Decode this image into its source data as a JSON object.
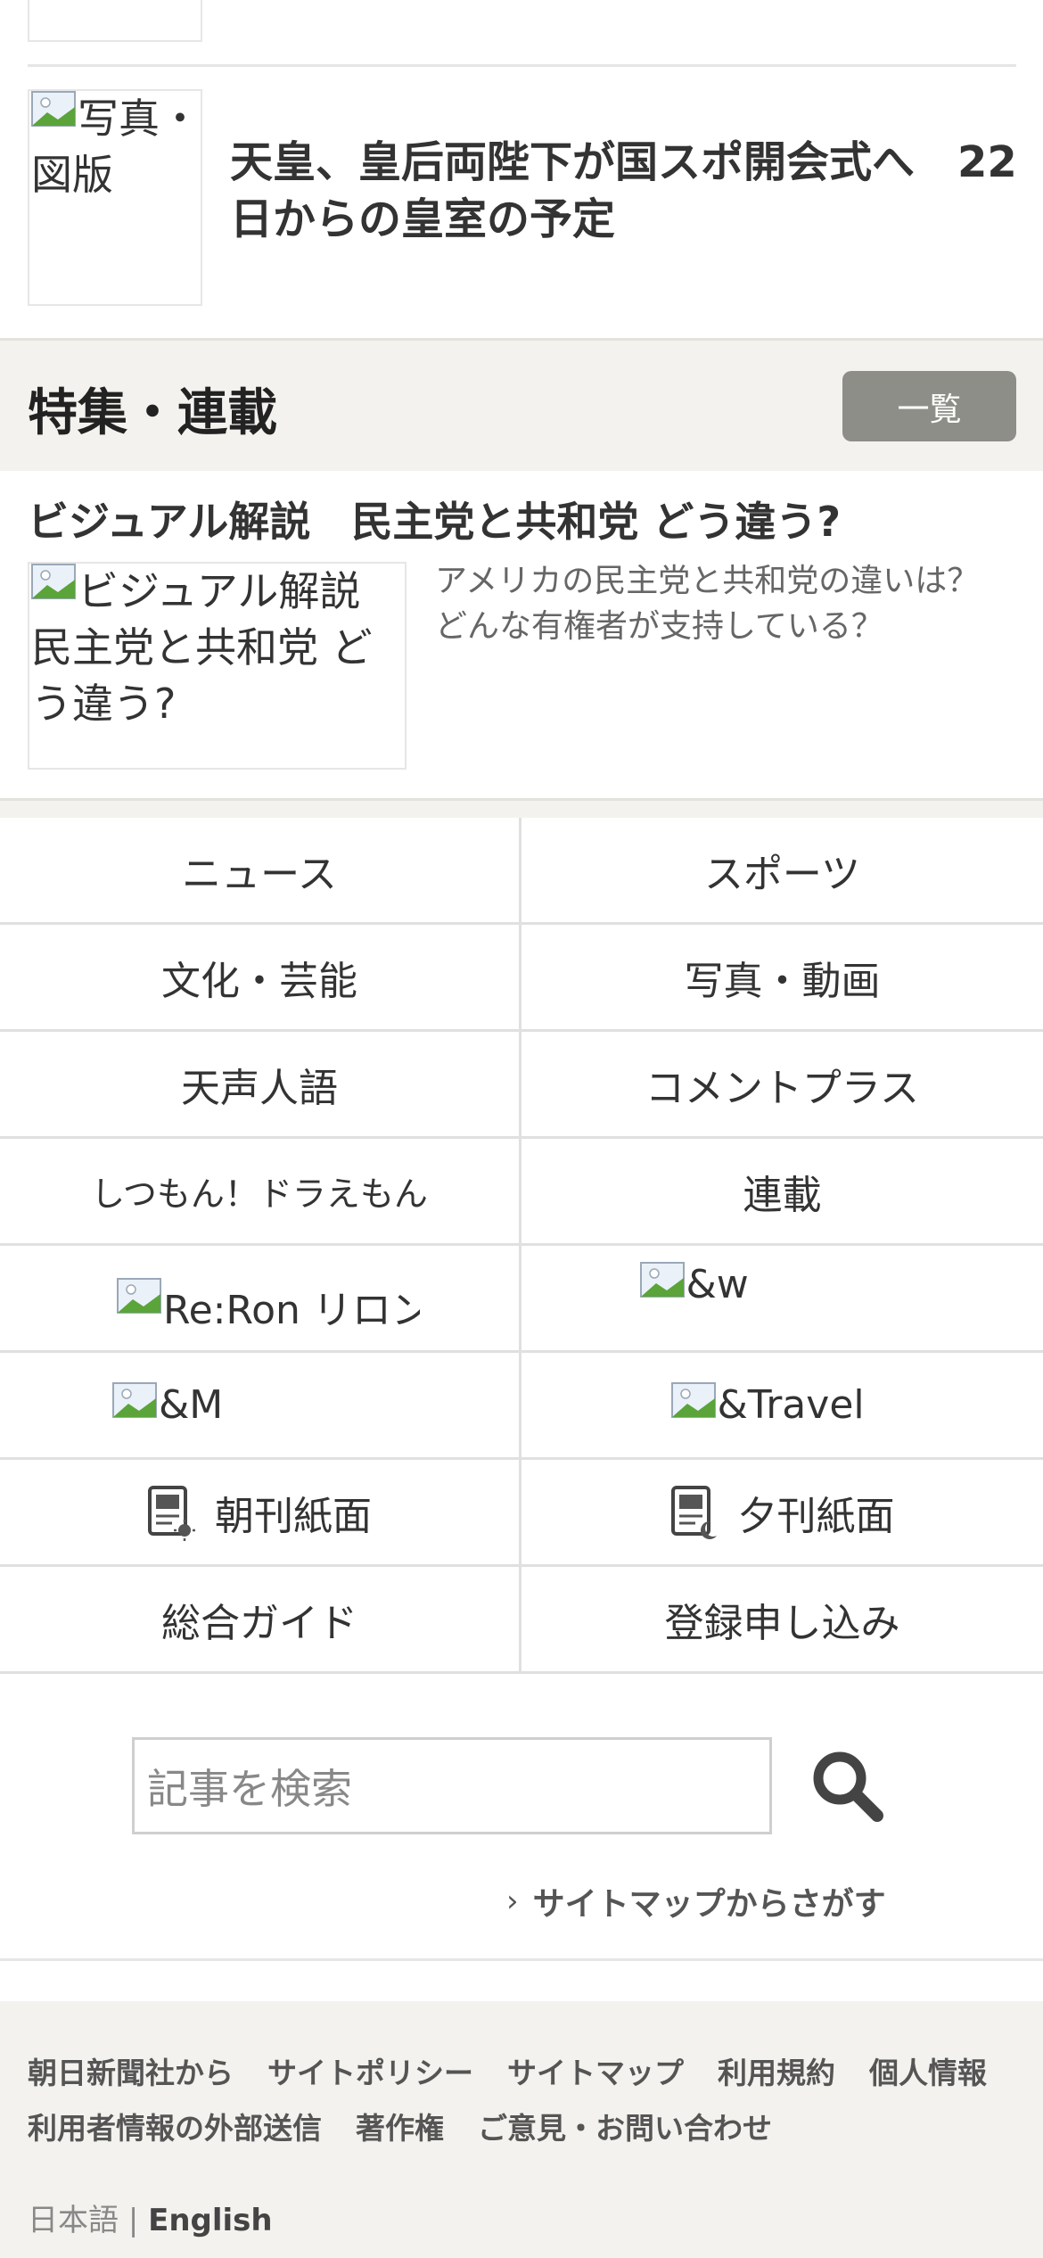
{
  "news": {
    "thumb_alt": "写真・図版",
    "title": "天皇、皇后両陛下が国スポ開会式へ　22日からの皇室の予定"
  },
  "feature": {
    "heading": "特集・連載",
    "all_button": "一覧",
    "title": "ビジュアル解説　民主党と共和党 どう違う?",
    "thumb_alt": "ビジュアル解説　民主党と共和党 どう違う?",
    "description": "アメリカの民主党と共和党の違いは？どんな有権者が支持している？"
  },
  "menu": {
    "news": "ニュース",
    "sports": "スポーツ",
    "culture": "文化・芸能",
    "photo_video": "写真・動画",
    "tensei": "天声人語",
    "comment_plus": "コメントプラス",
    "doraemon": "しつもん！ドラえもん",
    "rensai": "連載",
    "reron": "Re:Ron リロン",
    "andw": "&w",
    "andm": "&M",
    "andtravel": "&Travel",
    "morning": "朝刊紙面",
    "evening": "夕刊紙面",
    "guide": "総合ガイド",
    "register": "登録申し込み"
  },
  "search": {
    "placeholder": "記事を検索",
    "sitemap_link": "サイトマップからさがす"
  },
  "footer": {
    "links": [
      "朝日新聞社から",
      "サイトポリシー",
      "サイトマップ",
      "利用規約",
      "個人情報",
      "利用者情報の外部送信",
      "著作権",
      "ご意見・お問い合わせ"
    ],
    "lang_ja": "日本語",
    "lang_sep": "|",
    "lang_en": "English"
  },
  "colors": {
    "accent_gray": "#8e8e89",
    "band_bg": "#f3f2ee"
  }
}
